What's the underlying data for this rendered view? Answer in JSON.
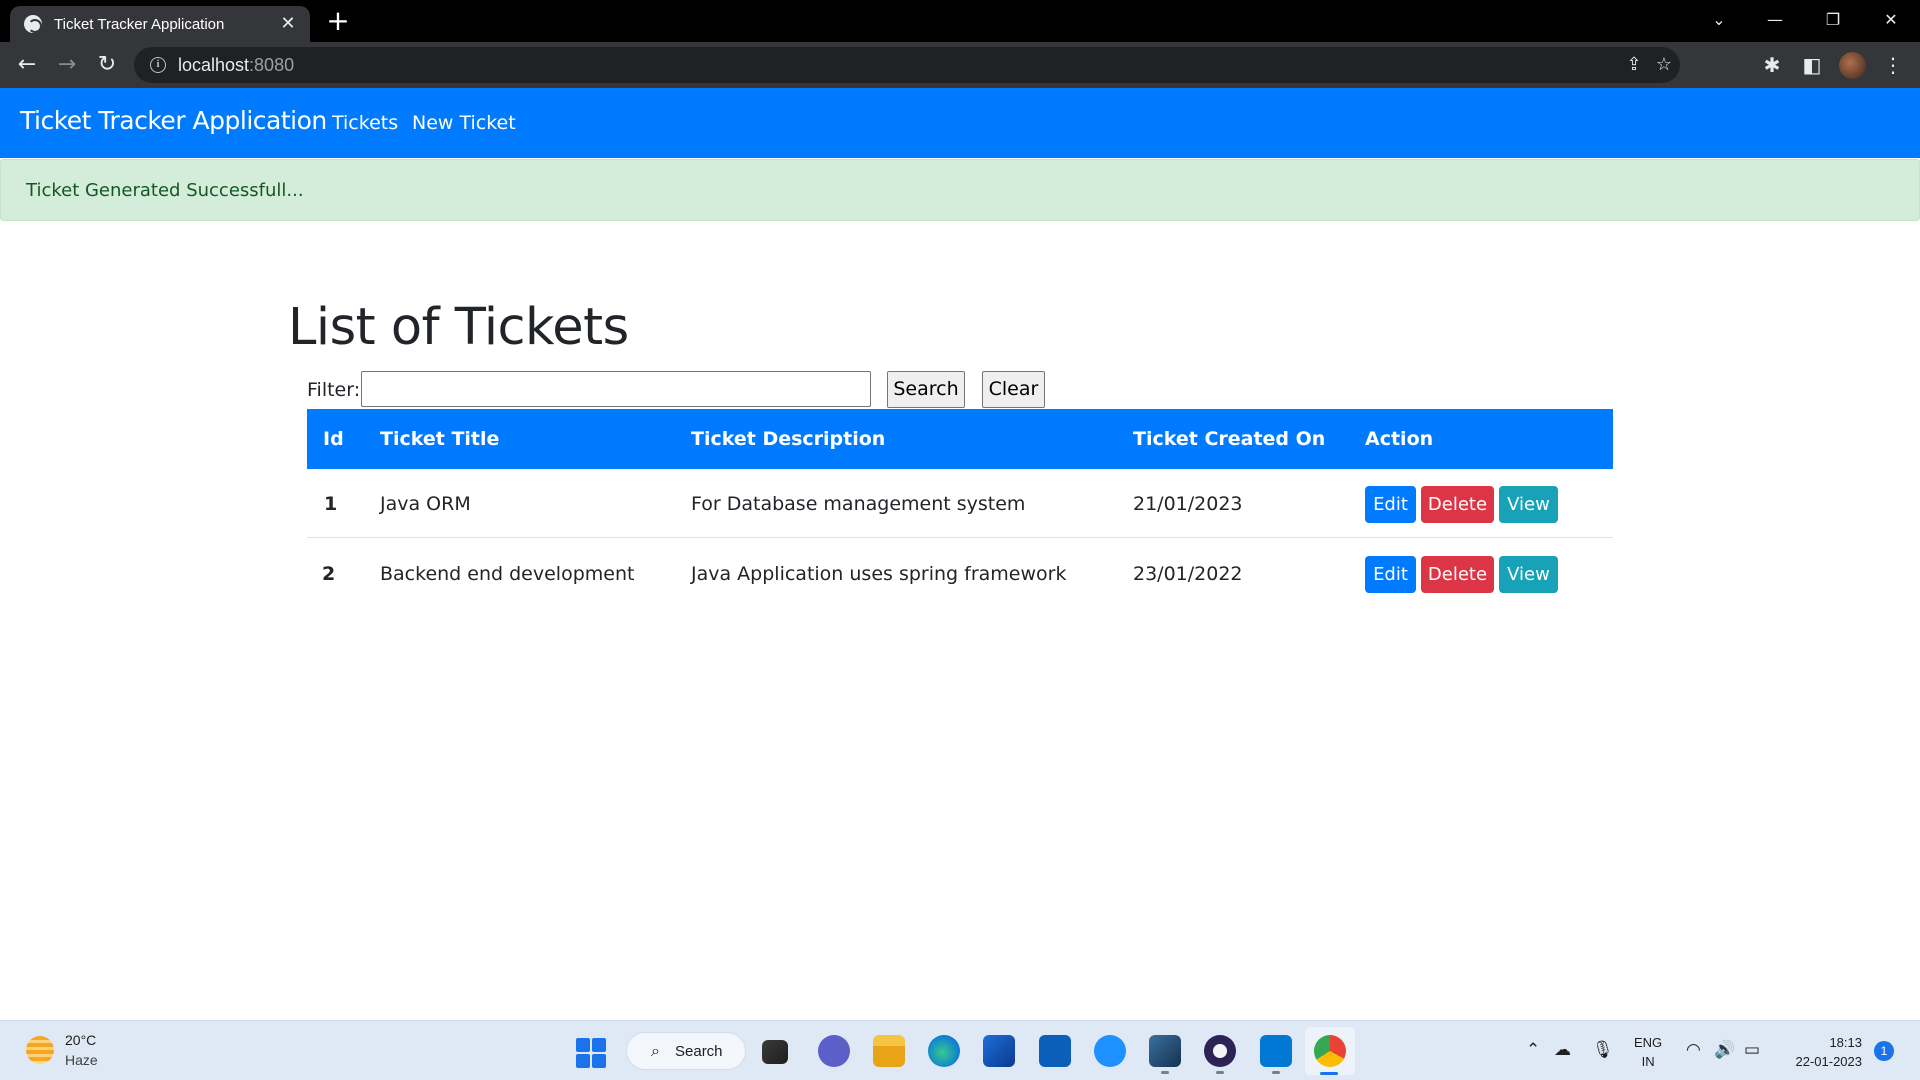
{
  "browser": {
    "tab_title": "Ticket Tracker Application",
    "url_host": "localhost",
    "url_port": ":8080"
  },
  "navbar": {
    "brand": "Ticket Tracker Application",
    "links": [
      "Tickets",
      "New Ticket"
    ],
    "color": "#007bff"
  },
  "alert": {
    "message": "Ticket Generated Successfull...",
    "color": "#d4edda"
  },
  "main": {
    "title": "List of Tickets",
    "filter": {
      "label": "Filter:",
      "value": "",
      "search_label": "Search",
      "clear_label": "Clear"
    },
    "table": {
      "headers": [
        "Id",
        "Ticket Title",
        "Ticket Description",
        "Ticket Created On",
        "Action"
      ],
      "rows": [
        {
          "id": "1",
          "title": "Java ORM",
          "description": "For Database management system",
          "created_on": "21/01/2023"
        },
        {
          "id": "2",
          "title": "Backend end development",
          "description": "Java Application uses spring framework",
          "created_on": "23/01/2022"
        }
      ],
      "actions": {
        "edit": "Edit",
        "delete": "Delete",
        "view": "View"
      },
      "action_colors": {
        "edit": "#007bff",
        "delete": "#dc3545",
        "view": "#17a2b8"
      }
    }
  },
  "taskbar": {
    "weather_temp": "20°C",
    "weather_condition": "Haze",
    "search_label": "Search",
    "language_line1": "ENG",
    "language_line2": "IN",
    "time": "18:13",
    "date": "22-01-2023",
    "notification_count": "1"
  }
}
